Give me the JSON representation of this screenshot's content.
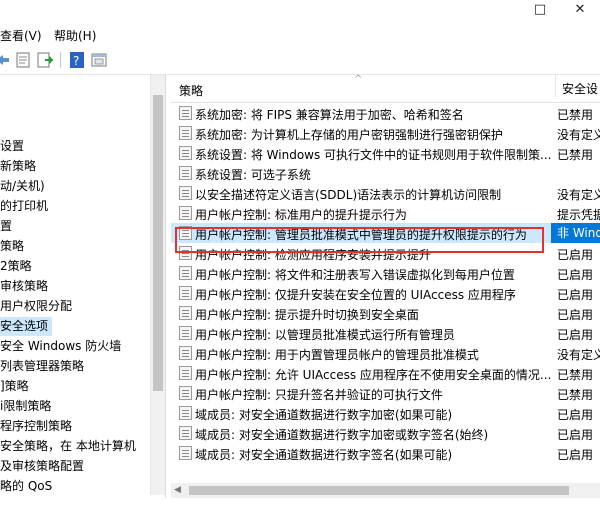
{
  "window": {
    "maximize_glyph": "□",
    "close_glyph": "✕"
  },
  "menu": {
    "view": "查看(V)",
    "help": "帮助(H)"
  },
  "toolbar": {
    "buttons": [
      "back-arrow-icon",
      "properties-icon",
      "export-list-icon",
      "help-icon",
      "show-hide-icon"
    ]
  },
  "tree": {
    "items": [
      {
        "label": "设置",
        "selected": false
      },
      {
        "label": "新策略",
        "selected": false
      },
      {
        "label": "动/关机)",
        "selected": false
      },
      {
        "label": "的打印机",
        "selected": false
      },
      {
        "label": "置",
        "selected": false
      },
      {
        "label": "策略",
        "selected": false
      },
      {
        "label": "2策略",
        "selected": false
      },
      {
        "label": "审核策略",
        "selected": false
      },
      {
        "label": "用户权限分配",
        "selected": false
      },
      {
        "label": "安全选项",
        "selected": true
      },
      {
        "label": "安全 Windows 防火墙",
        "selected": false
      },
      {
        "label": "列表管理器策略",
        "selected": false
      },
      {
        "label": "]策略",
        "selected": false
      },
      {
        "label": "i限制策略",
        "selected": false
      },
      {
        "label": "程序控制策略",
        "selected": false
      },
      {
        "label": "安全策略，在 本地计算机",
        "selected": false
      },
      {
        "label": "及审核策略配置",
        "selected": false
      },
      {
        "label": "略的 QoS",
        "selected": false
      }
    ]
  },
  "list": {
    "header_policy": "策略",
    "header_setting": "安全设",
    "rows": [
      {
        "name": "系统加密: 将 FIPS 兼容算法用于加密、哈希和签名",
        "setting": "已禁用"
      },
      {
        "name": "系统加密: 为计算机上存储的用户密钥强制进行强密钥保护",
        "setting": "没有定义"
      },
      {
        "name": "系统设置: 将 Windows 可执行文件中的证书规则用于软件限制策...",
        "setting": "已禁用"
      },
      {
        "name": "系统设置: 可选子系统",
        "setting": ""
      },
      {
        "name": "以安全描述符定义语言(SDDL)语法表示的计算机访问限制",
        "setting": "没有定义"
      },
      {
        "name": "用户帐户控制: 标准用户的提升提示行为",
        "setting": "提示凭据"
      },
      {
        "name": "用户帐户控制: 管理员批准模式中管理员的提升权限提示的行为",
        "setting": "非 Wind"
      },
      {
        "name": "用户帐户控制: 检测应用程序安装并提示提升",
        "setting": "已启用"
      },
      {
        "name": "用户帐户控制: 将文件和注册表写入错误虚拟化到每用户位置",
        "setting": "已启用"
      },
      {
        "name": "用户帐户控制: 仅提升安装在安全位置的 UIAccess 应用程序",
        "setting": "已启用"
      },
      {
        "name": "用户帐户控制: 提示提升时切换到安全桌面",
        "setting": "已启用"
      },
      {
        "name": "用户帐户控制: 以管理员批准模式运行所有管理员",
        "setting": "已启用"
      },
      {
        "name": "用户帐户控制: 用于内置管理员帐户的管理员批准模式",
        "setting": "没有定义"
      },
      {
        "name": "用户帐户控制: 允许 UIAccess 应用程序在不使用安全桌面的情况...",
        "setting": "已禁用"
      },
      {
        "name": "用户帐户控制: 只提升签名并验证的可执行文件",
        "setting": "已禁用"
      },
      {
        "name": "域成员: 对安全通道数据进行数字加密(如果可能)",
        "setting": "已启用"
      },
      {
        "name": "域成员: 对安全通道数据进行数字加密或数字签名(始终)",
        "setting": "已启用"
      },
      {
        "name": "域成员: 对安全通道数据进行数字签名(如果可能)",
        "setting": "已启用"
      }
    ],
    "selected_index": 6
  },
  "colors": {
    "selection": "#cce8ff",
    "accent": "#0078d7",
    "highlight_box": "#e2322b"
  }
}
